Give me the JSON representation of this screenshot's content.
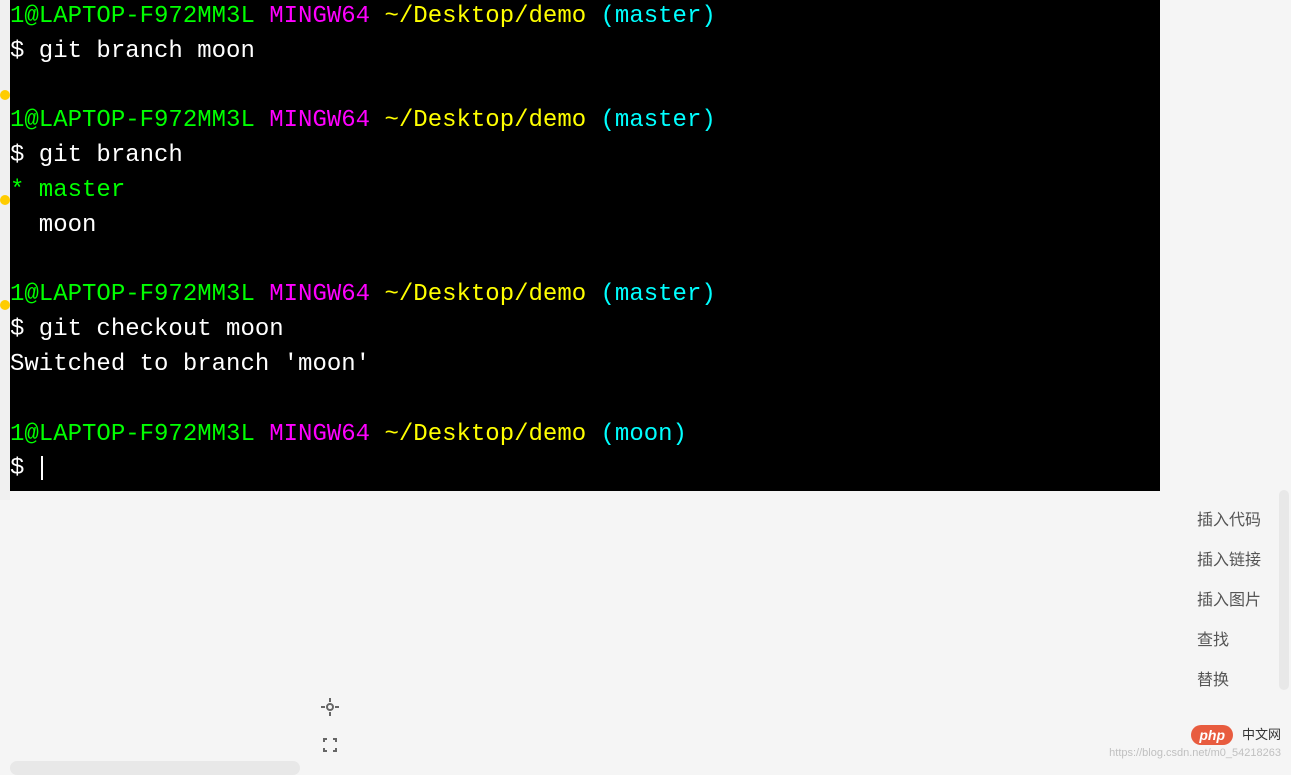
{
  "terminal": {
    "blocks": [
      {
        "user_host": "1@LAPTOP-F972MM3L",
        "env": "MINGW64",
        "path": "~/Desktop/demo",
        "branch": "(master)",
        "command": "git branch moon",
        "output": []
      },
      {
        "user_host": "1@LAPTOP-F972MM3L",
        "env": "MINGW64",
        "path": "~/Desktop/demo",
        "branch": "(master)",
        "command": "git branch",
        "output": [
          {
            "text": "* master",
            "class": "green"
          },
          {
            "text": "  moon",
            "class": "white"
          }
        ]
      },
      {
        "user_host": "1@LAPTOP-F972MM3L",
        "env": "MINGW64",
        "path": "~/Desktop/demo",
        "branch": "(master)",
        "command": "git checkout moon",
        "output": [
          {
            "text": "Switched to branch 'moon'",
            "class": "white"
          }
        ]
      },
      {
        "user_host": "1@LAPTOP-F972MM3L",
        "env": "MINGW64",
        "path": "~/Desktop/demo",
        "branch": "(moon)",
        "command": "",
        "output": []
      }
    ]
  },
  "sidebar": {
    "items": [
      "插入代码",
      "插入链接",
      "插入图片",
      "查找",
      "替换"
    ]
  },
  "badge": {
    "php": "php",
    "cn": "中文网"
  },
  "watermark": "https://blog.csdn.net/m0_54218263",
  "icons": {
    "target": "target-icon",
    "expand": "expand-icon"
  }
}
